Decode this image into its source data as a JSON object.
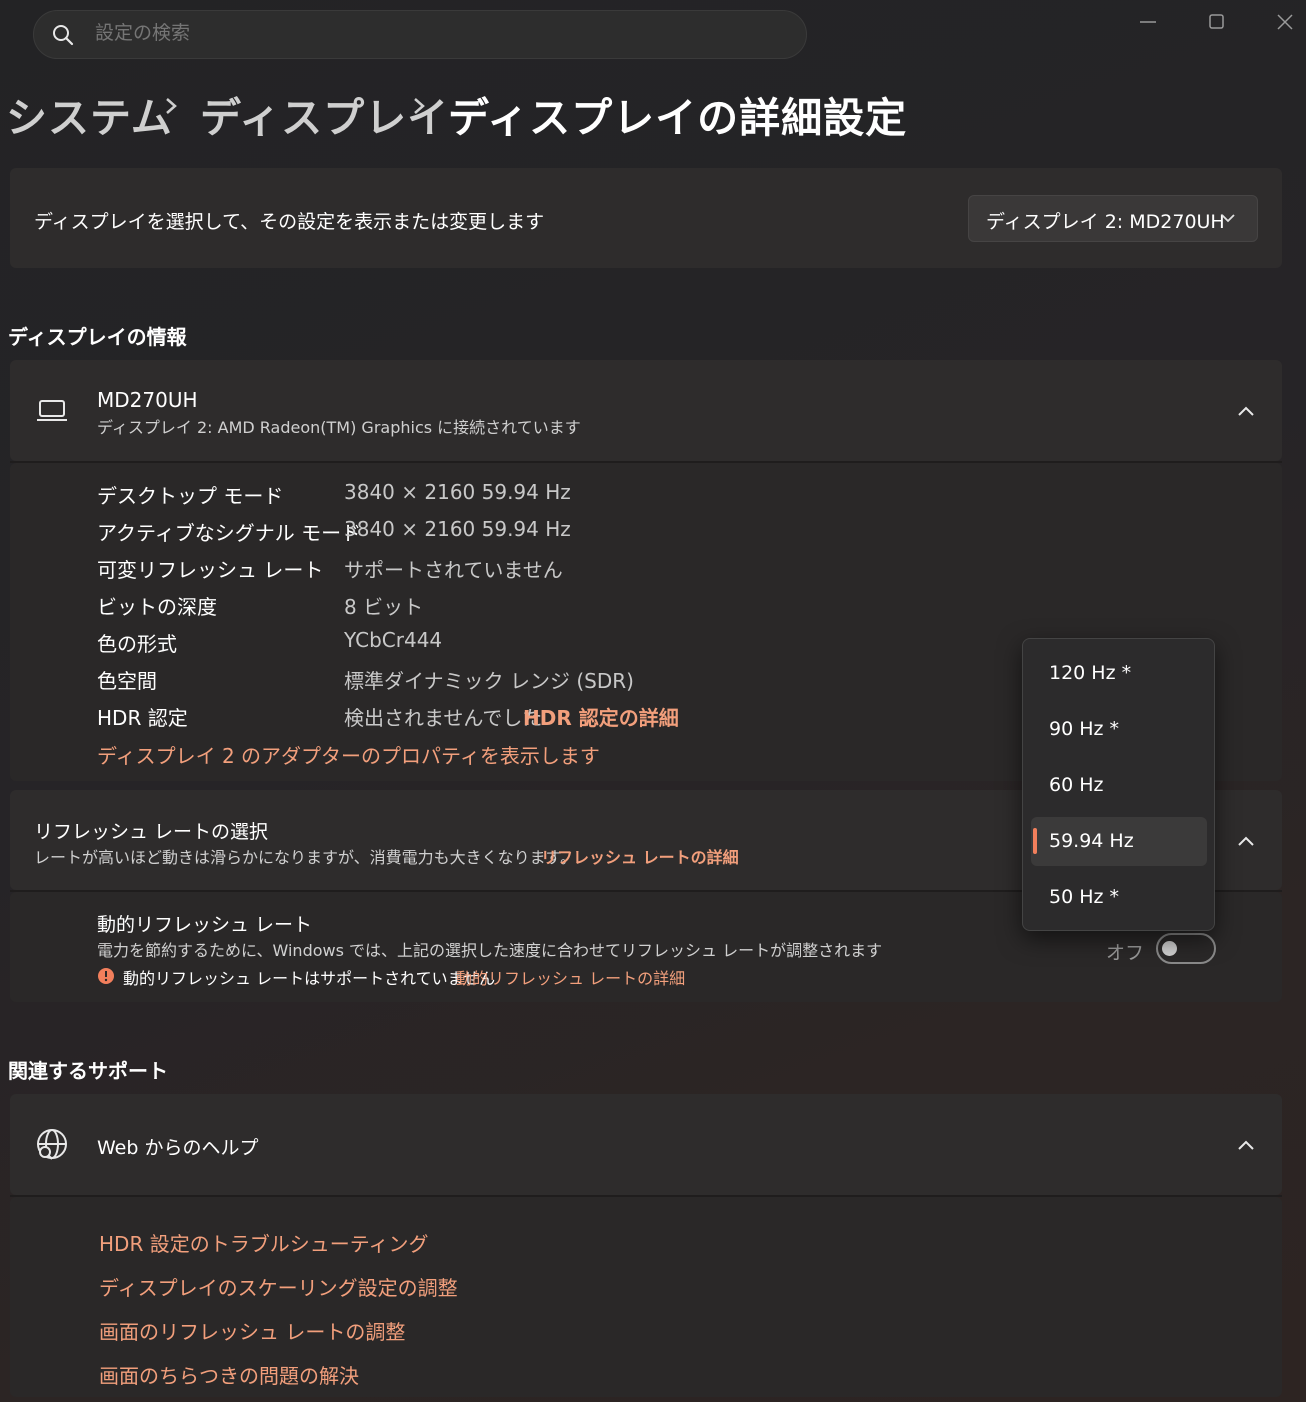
{
  "search": {
    "placeholder": "設定の検索"
  },
  "breadcrumb": {
    "items": [
      "システム",
      "ディスプレイ",
      "ディスプレイの詳細設定"
    ]
  },
  "display_select": {
    "label": "ディスプレイを選択して、その設定を表示または変更します",
    "selected": "ディスプレイ 2: MD270UH"
  },
  "display_info": {
    "section_title": "ディスプレイの情報",
    "monitor_name": "MD270UH",
    "monitor_desc": "ディスプレイ 2: AMD Radeon(TM) Graphics に接続されています",
    "rows": [
      {
        "key": "デスクトップ モード",
        "value": "3840 × 2160 59.94 Hz"
      },
      {
        "key": "アクティブなシグナル モード",
        "value": "3840 × 2160 59.94 Hz"
      },
      {
        "key": "可変リフレッシュ レート",
        "value": "サポートされていません"
      },
      {
        "key": "ビットの深度",
        "value": "8 ビット"
      },
      {
        "key": "色の形式",
        "value": "YCbCr444"
      },
      {
        "key": "色空間",
        "value": "標準ダイナミック レンジ (SDR)"
      },
      {
        "key": "HDR 認定",
        "value": "検出されませんでした"
      }
    ],
    "hdr_link": "HDR 認定の詳細",
    "adapter_link": "ディスプレイ 2 のアダプターのプロパティを表示します"
  },
  "refresh": {
    "title": "リフレッシュ レートの選択",
    "desc": "レートが高いほど動きは滑らかになりますが、消費電力も大きくなります。",
    "link": "リフレッシュ レートの詳細",
    "options": [
      "120 Hz *",
      "90 Hz *",
      "60 Hz",
      "59.94 Hz",
      "50 Hz *"
    ],
    "selected": "59.94 Hz"
  },
  "dynamic_refresh": {
    "title": "動的リフレッシュ レート",
    "desc": "電力を節約するために、Windows では、上記の選択した速度に合わせてリフレッシュ レートが調整されます",
    "warning": "動的リフレッシュ レートはサポートされていません",
    "link": "動的リフレッシュ レートの詳細",
    "toggle_label": "オフ"
  },
  "support": {
    "section_title": "関連するサポート",
    "help_title": "Web からのヘルプ",
    "links": [
      "HDR 設定のトラブルシューティング",
      "ディスプレイのスケーリング設定の調整",
      "画面のリフレッシュ レートの調整",
      "画面のちらつきの問題の解決"
    ]
  },
  "colors": {
    "accent": "#f29f7c",
    "indicator": "#f27f5c"
  },
  "icons": [
    "search-icon",
    "minimize-icon",
    "maximize-icon",
    "close-icon",
    "laptop-icon",
    "chevron-up-icon",
    "chevron-down-icon",
    "info-icon",
    "globe-icon"
  ]
}
